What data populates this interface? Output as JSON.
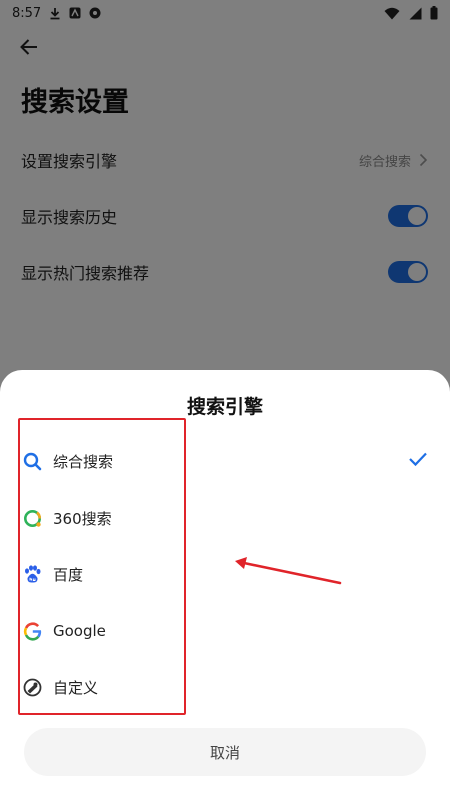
{
  "status_bar": {
    "time": "8:57"
  },
  "header": {
    "back_icon": "arrow-left-icon",
    "title": "搜索设置"
  },
  "settings": [
    {
      "label": "设置搜索引擎",
      "value": "综合搜索",
      "type": "link"
    },
    {
      "label": "显示搜索历史",
      "type": "toggle",
      "enabled": true
    },
    {
      "label": "显示热门搜索推荐",
      "type": "toggle",
      "enabled": true
    }
  ],
  "sheet": {
    "title": "搜索引擎",
    "engines": [
      {
        "label": "综合搜索",
        "icon": "search-icon",
        "selected": true
      },
      {
        "label": "360搜索",
        "icon": "360-logo-icon",
        "selected": false
      },
      {
        "label": "百度",
        "icon": "baidu-paw-icon",
        "selected": false
      },
      {
        "label": "Google",
        "icon": "google-g-icon",
        "selected": false
      },
      {
        "label": "自定义",
        "icon": "custom-engine-icon",
        "selected": false
      }
    ],
    "cancel_label": "取消"
  },
  "colors": {
    "accent": "#1f6fe5",
    "annotation": "#e0242a"
  }
}
